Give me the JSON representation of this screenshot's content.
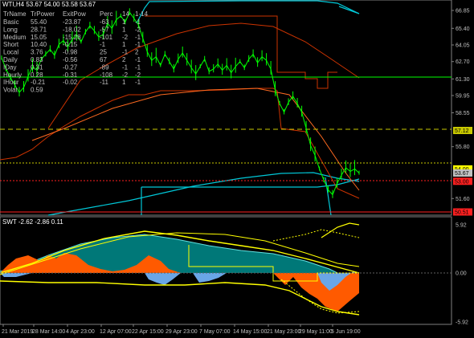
{
  "window": {
    "symbol_line": "WTI,H4  53.67 54.00 53.58 53.67",
    "indicator_line": "SWT -2.62 -2.86 0.11"
  },
  "table": {
    "headers": [
      "TrName",
      "TrPower",
      "ExitPow",
      "Perc",
      "14",
      "1-14"
    ],
    "rows": [
      [
        "Basic",
        "55.40",
        "-23.87",
        "-63",
        "1",
        "-1"
      ],
      [
        "Long",
        "28.71",
        "-18.02",
        "-57",
        "1",
        "-2"
      ],
      [
        "Medium",
        "15.05",
        "-15.28",
        "-101",
        "-2",
        "-1"
      ],
      [
        "Short",
        "10.40",
        "-0.15",
        "-1",
        "1",
        "-1"
      ],
      [
        "Local",
        "3.76",
        "-0.98",
        "25",
        "-1",
        "2"
      ],
      [
        "Daily",
        "0.83",
        "-0.56",
        "67",
        "2",
        "-1"
      ],
      [
        "IDay",
        "0.31",
        "-0.27",
        "-89",
        "-1",
        "-1"
      ],
      [
        "Hourly",
        "0.28",
        "-0.31",
        "-108",
        "-2",
        "-2"
      ],
      [
        "IHour",
        "-0.21",
        "-0.02",
        "-11",
        "1",
        "-1"
      ],
      [
        "Volat",
        "0.59",
        "",
        "",
        "",
        ""
      ]
    ]
  },
  "price_axis": {
    "ticks": [
      "66.85",
      "65.40",
      "64.05",
      "62.70",
      "61.30",
      "59.95",
      "58.55",
      "57.12",
      "55.80",
      "54.00",
      "53.67",
      "53.00",
      "51.60",
      "50.51"
    ],
    "levels": [
      {
        "value": "61.38",
        "color": "#00ff00"
      },
      {
        "value": "57.12",
        "color": "#c8c800"
      },
      {
        "value": "54.00",
        "color": "#ffff00"
      },
      {
        "value": "53.67",
        "color": "#c0c0c0"
      },
      {
        "value": "53.00",
        "color": "#ff2020"
      },
      {
        "value": "50.51",
        "color": "#ff2020"
      }
    ]
  },
  "indicator_axis": {
    "ticks": [
      "5.92",
      "0.00",
      "-5.92"
    ]
  },
  "time_axis": {
    "labels": [
      "21 Mar 2019",
      "28 Mar 14:00",
      "4 Apr 23:00",
      "12 Apr 07:00",
      "22 Apr 15:00",
      "29 Apr 23:00",
      "7 May 07:00",
      "14 May 15:00",
      "21 May 23:00",
      "29 May 11:00",
      "5 Jun 19:00"
    ]
  },
  "colors": {
    "price": "#00ff00",
    "red_channel": "#cc3300",
    "cyan": "#00c8d8",
    "yellow": "#ffff00",
    "orange_fill": "#ff5a00",
    "teal_fill": "#00a0a0",
    "blue_fill": "#6aa6e6"
  },
  "chart_data": {
    "type": "line",
    "series": [
      {
        "values": [
          63.0,
          62.1,
          61.4,
          60.8,
          60.2,
          60.6,
          61.5,
          62.3,
          62.0,
          62.9,
          63.3,
          63.7,
          63.2,
          64.1,
          64.4,
          63.9,
          64.5,
          64.9,
          64.3,
          65.1,
          65.6,
          65.2,
          64.7,
          64.9,
          65.8,
          65.4,
          66.1,
          66.4,
          65.9,
          66.7,
          66.2,
          65.7,
          64.6,
          63.5,
          62.8,
          63.1,
          62.4,
          63.3,
          62.7,
          62.1,
          62.9,
          63.4,
          62.8,
          62.2,
          61.7,
          62.3,
          62.9,
          61.9,
          62.1,
          62.5,
          62.0,
          62.4,
          61.8,
          62.3,
          62.7,
          62.2,
          62.9,
          63.3,
          62.6,
          63.1,
          62.8,
          62.1,
          60.4,
          59.3,
          58.6,
          59.4,
          59.9,
          59.3,
          58.6,
          57.3,
          55.9,
          55.1,
          54.0,
          53.1,
          52.3,
          51.9,
          52.8,
          53.5,
          54.1,
          53.8,
          54.0,
          53.67
        ]
      }
    ]
  }
}
